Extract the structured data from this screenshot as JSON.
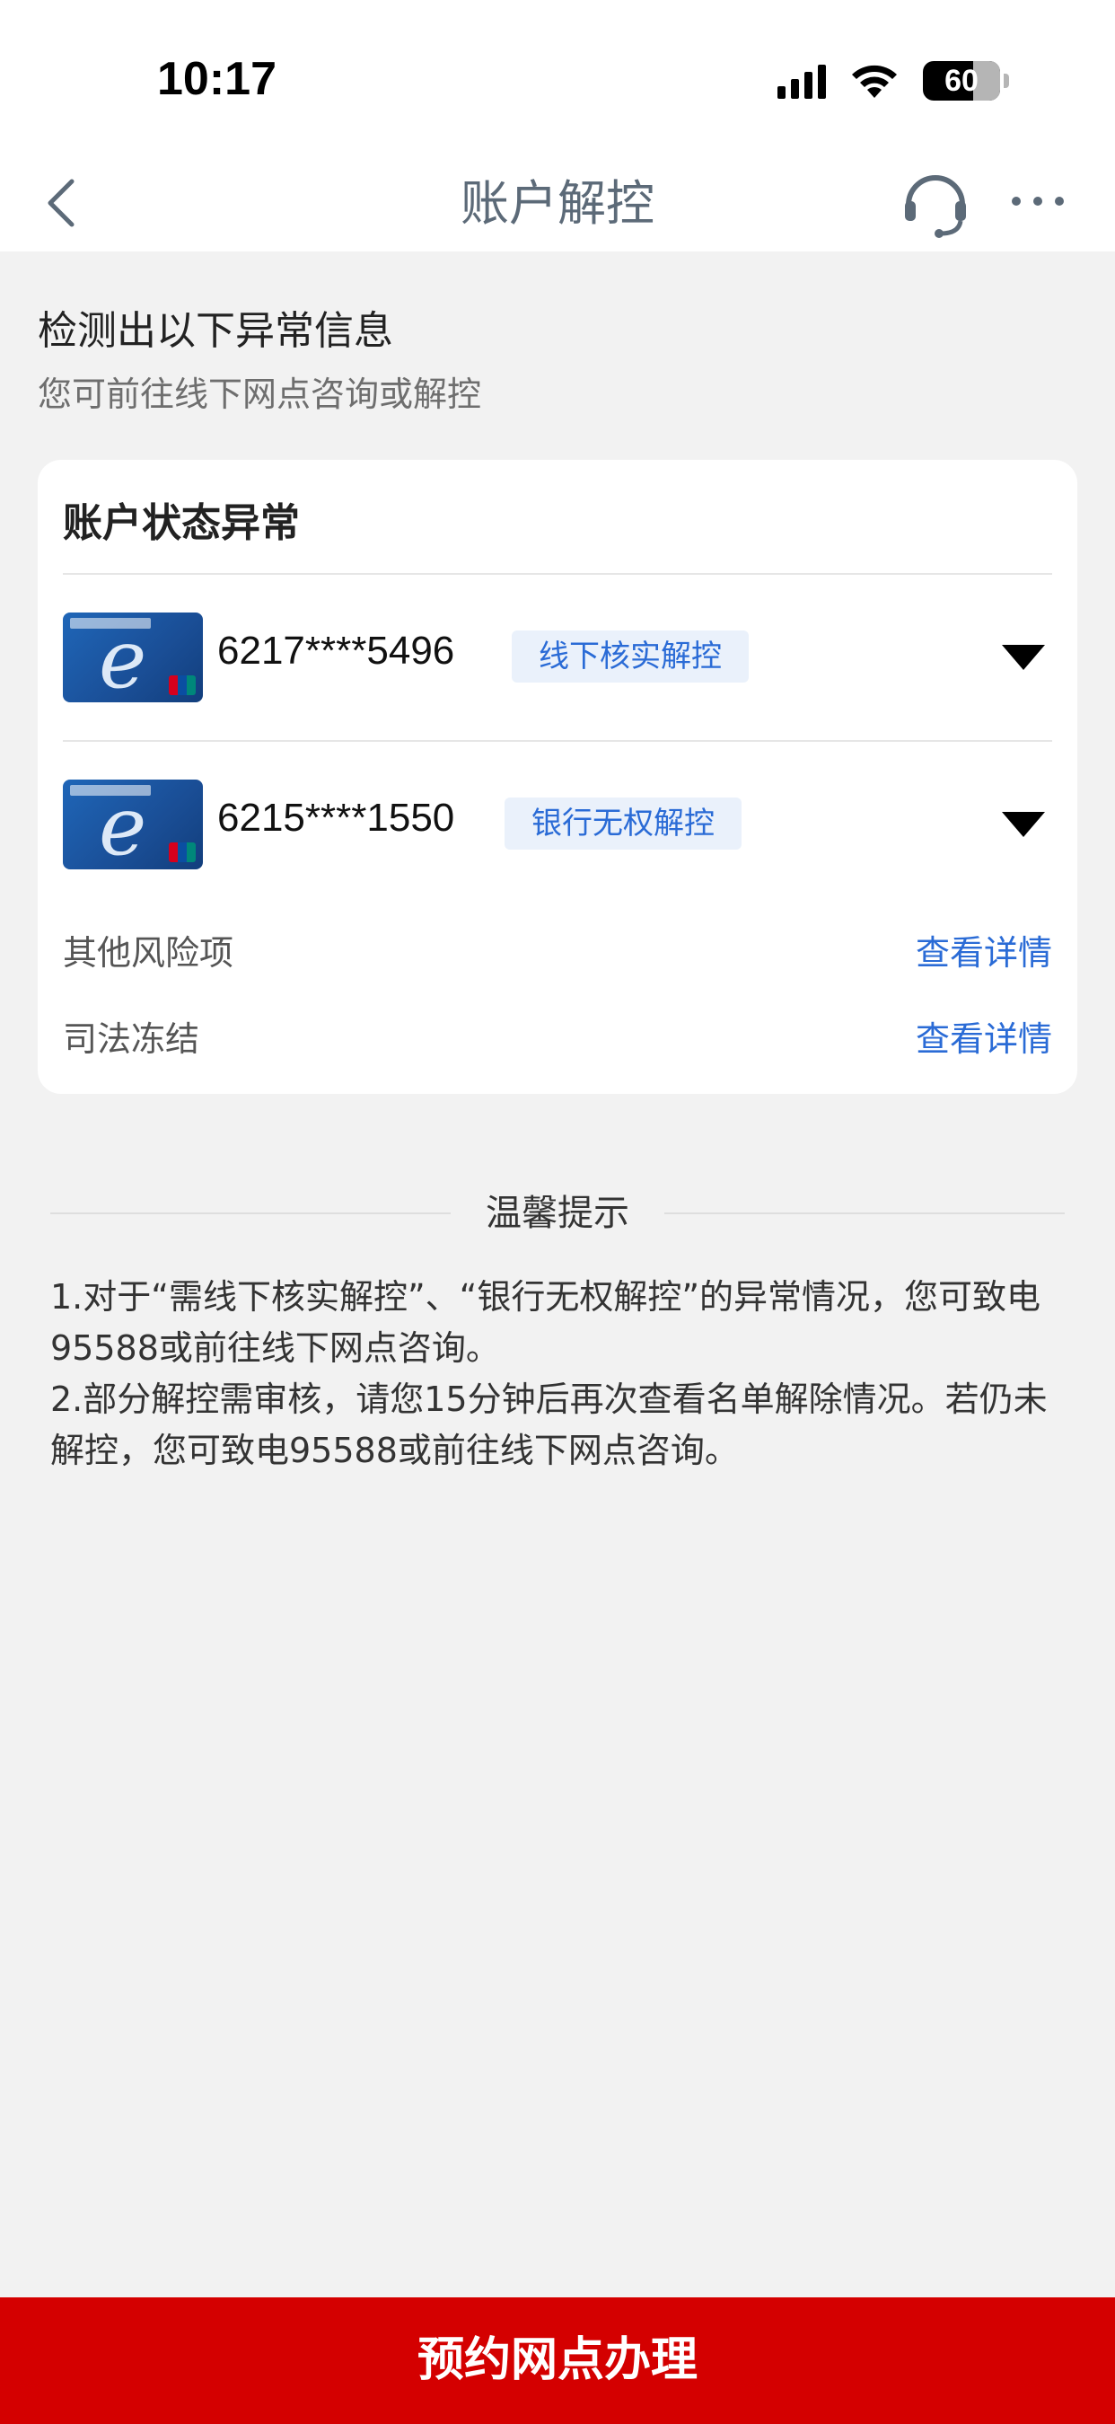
{
  "status_bar": {
    "time": "10:17",
    "battery": "60"
  },
  "nav": {
    "title": "账户解控",
    "back_icon": "chevron-left-icon",
    "service_icon": "headset-icon",
    "more_icon": "more-dots-icon"
  },
  "header": {
    "title": "检测出以下异常信息",
    "subtitle": "您可前往线下网点咨询或解控"
  },
  "card": {
    "title": "账户状态异常",
    "accounts": [
      {
        "number": "6217****5496",
        "tag": "线下核实解控"
      },
      {
        "number": "6215****1550",
        "tag": "银行无权解控"
      }
    ],
    "risks": [
      {
        "label": "其他风险项",
        "link": "查看详情"
      },
      {
        "label": "司法冻结",
        "link": "查看详情"
      }
    ]
  },
  "tips": {
    "title": "温馨提示",
    "lines": [
      "1.对于“需线下核实解控”、“银行无权解控”的异常情况，您可致电95588或前往线下网点咨询。",
      "2.部分解控需审核，请您15分钟后再次查看名单解除情况。若仍未解控，您可致电95588或前往线下网点咨询。"
    ]
  },
  "bottom_button": {
    "label": "预约网点办理"
  },
  "colors": {
    "accent_red": "#d40000",
    "link_blue": "#2a6bd6",
    "tag_bg": "#eaf1fb"
  }
}
